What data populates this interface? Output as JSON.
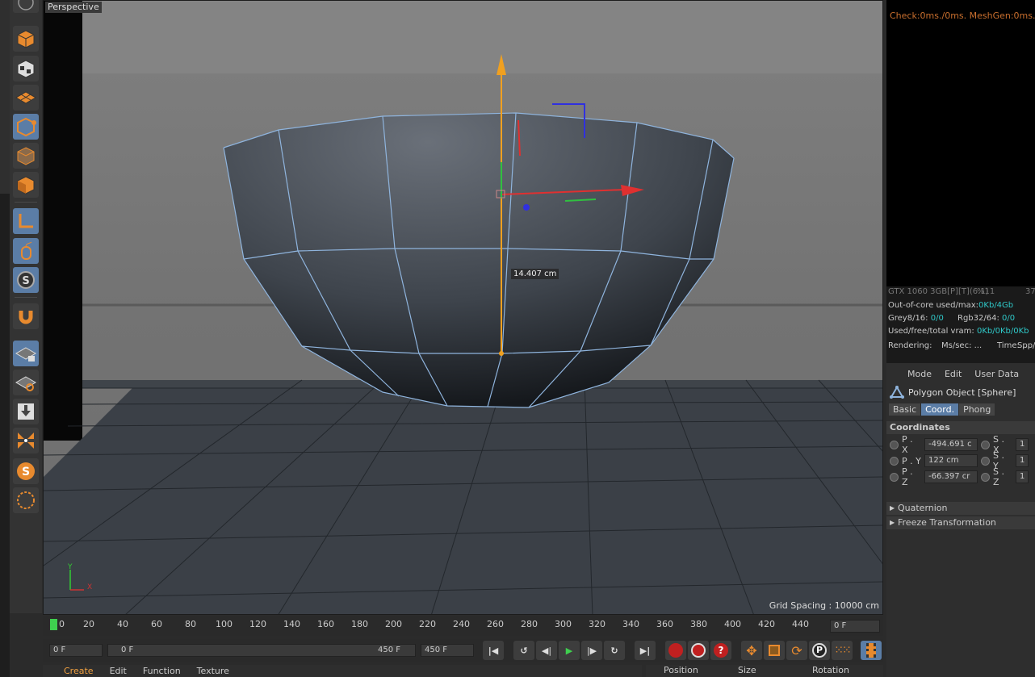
{
  "viewport": {
    "label": "Perspective",
    "hud_value": "14.407 cm",
    "grid_spacing": "Grid Spacing : 10000 cm",
    "axis_y": "Y",
    "axis_x": "X"
  },
  "render_panel": {
    "status": "Check:0ms./0ms. MeshGen:0ms. Up",
    "gpu": "GTX 1060 3GB[P][T](6.1)",
    "gpu_pct": "%11",
    "gpu_extra": "37",
    "out_of_core_label": "Out-of-core used/max:",
    "out_of_core_value": "0Kb/4Gb",
    "grey_label": "Grey8/16:",
    "grey_value": "0/0",
    "rgb_label": "Rgb32/64:",
    "rgb_value": "0/0",
    "vram_label": "Used/free/total vram:",
    "vram_value": "0Kb/0Kb/0Kb",
    "rendering": "Rendering:",
    "ms_sec": "Ms/sec: ...",
    "time": "Time: ...",
    "spp": "Spp/"
  },
  "attributes": {
    "menu": [
      "Mode",
      "Edit",
      "User Data"
    ],
    "object_title": "Polygon Object [Sphere]",
    "tabs": [
      "Basic",
      "Coord.",
      "Phong"
    ],
    "section": "Coordinates",
    "rows": [
      {
        "p_label": "P . X",
        "p_value": "-494.691 c",
        "s_label": "S . X",
        "s_value": "1"
      },
      {
        "p_label": "P . Y",
        "p_value": "122 cm",
        "s_label": "S . Y",
        "s_value": "1"
      },
      {
        "p_label": "P . Z",
        "p_value": "-66.397 cr",
        "s_label": "S . Z",
        "s_value": "1"
      }
    ],
    "folds": [
      "Quaternion",
      "Freeze Transformation"
    ]
  },
  "timeline": {
    "ticks": [
      "0",
      "20",
      "40",
      "60",
      "80",
      "100",
      "120",
      "140",
      "160",
      "180",
      "200",
      "220",
      "240",
      "260",
      "280",
      "300",
      "320",
      "340",
      "360",
      "380",
      "400",
      "420",
      "440"
    ],
    "current_frame": "0 F"
  },
  "transport": {
    "start_field": "0 F",
    "range_start": "0 F",
    "range_end": "450 F",
    "end_field": "450 F"
  },
  "bottom_menu": [
    "Create",
    "Edit",
    "Function",
    "Texture"
  ],
  "coord_headers": [
    "Position",
    "Size",
    "Rotation"
  ],
  "colors": {
    "accent": "#5b7da6",
    "orange": "#f0a040",
    "status": "#c96f2e",
    "cyan": "#2fc9c9"
  }
}
